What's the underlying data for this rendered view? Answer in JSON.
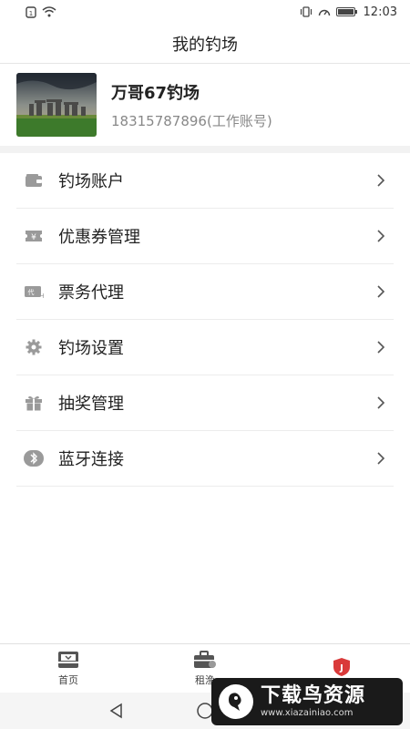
{
  "status_bar": {
    "time": "12:03"
  },
  "header": {
    "title": "我的钓场"
  },
  "profile": {
    "name": "万哥67钓场",
    "phone": "18315787896(工作账号)"
  },
  "menu": [
    {
      "label": "钓场账户",
      "icon": "wallet-icon"
    },
    {
      "label": "优惠券管理",
      "icon": "coupon-icon"
    },
    {
      "label": "票务代理",
      "icon": "ticket-icon"
    },
    {
      "label": "钓场设置",
      "icon": "gear-icon"
    },
    {
      "label": "抽奖管理",
      "icon": "gift-icon"
    },
    {
      "label": "蓝牙连接",
      "icon": "bluetooth-icon"
    }
  ],
  "tabs": [
    {
      "label": "首页",
      "icon": "home-inbox-icon",
      "active": false
    },
    {
      "label": "租渔",
      "icon": "briefcase-icon",
      "active": false
    },
    {
      "label": "",
      "icon": "shield-icon",
      "active": true
    }
  ],
  "watermark": {
    "title": "下载鸟资源",
    "url": "www.xiazainiao.com"
  },
  "colors": {
    "accent": "#d93a3a",
    "icon_gray": "#9a9a9a",
    "divider": "#ececec"
  }
}
